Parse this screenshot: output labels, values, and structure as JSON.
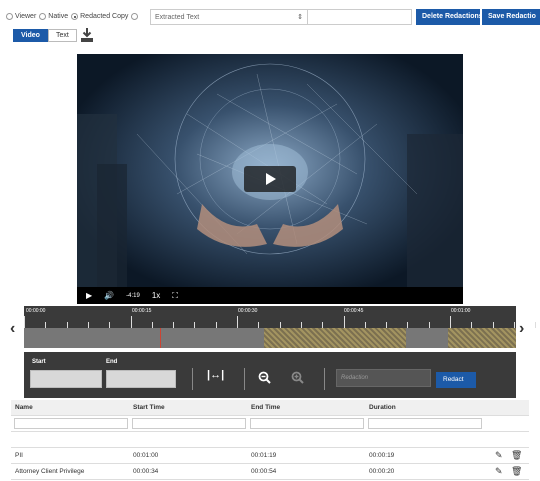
{
  "viewer_options": [
    {
      "label": "Viewer",
      "selected": false
    },
    {
      "label": "Native",
      "selected": false
    },
    {
      "label": "Redacted Copy",
      "selected": true
    }
  ],
  "extract_select": {
    "value": "Extracted Text"
  },
  "toolbar": {
    "delete_label": "Delete Redactions",
    "save_label": "Save Redactio"
  },
  "tabs": [
    {
      "label": "Video",
      "active": true
    },
    {
      "label": "Text",
      "active": false
    }
  ],
  "video": {
    "time_remaining": "-4:19",
    "speed": "1x"
  },
  "timeline": {
    "tick_labels": [
      "00:00:00",
      "00:00:15",
      "00:00:30",
      "00:00:45",
      "00:01:00"
    ]
  },
  "editor": {
    "start_label": "Start",
    "end_label": "End",
    "redaction_placeholder": "Redaction",
    "redact_label": "Redact"
  },
  "table": {
    "headers": [
      "Name",
      "Start Time",
      "End Time",
      "Duration"
    ],
    "rows": [
      {
        "name": "PII",
        "start": "00:01:00",
        "end": "00:01:19",
        "duration": "00:00:19"
      },
      {
        "name": "Attorney Client Privilege",
        "start": "00:00:34",
        "end": "00:00:54",
        "duration": "00:00:20"
      }
    ]
  },
  "colors": {
    "accent": "#1c5aa8",
    "timeline_bg": "#3a3a3a",
    "redaction_segment": "#a39460"
  }
}
